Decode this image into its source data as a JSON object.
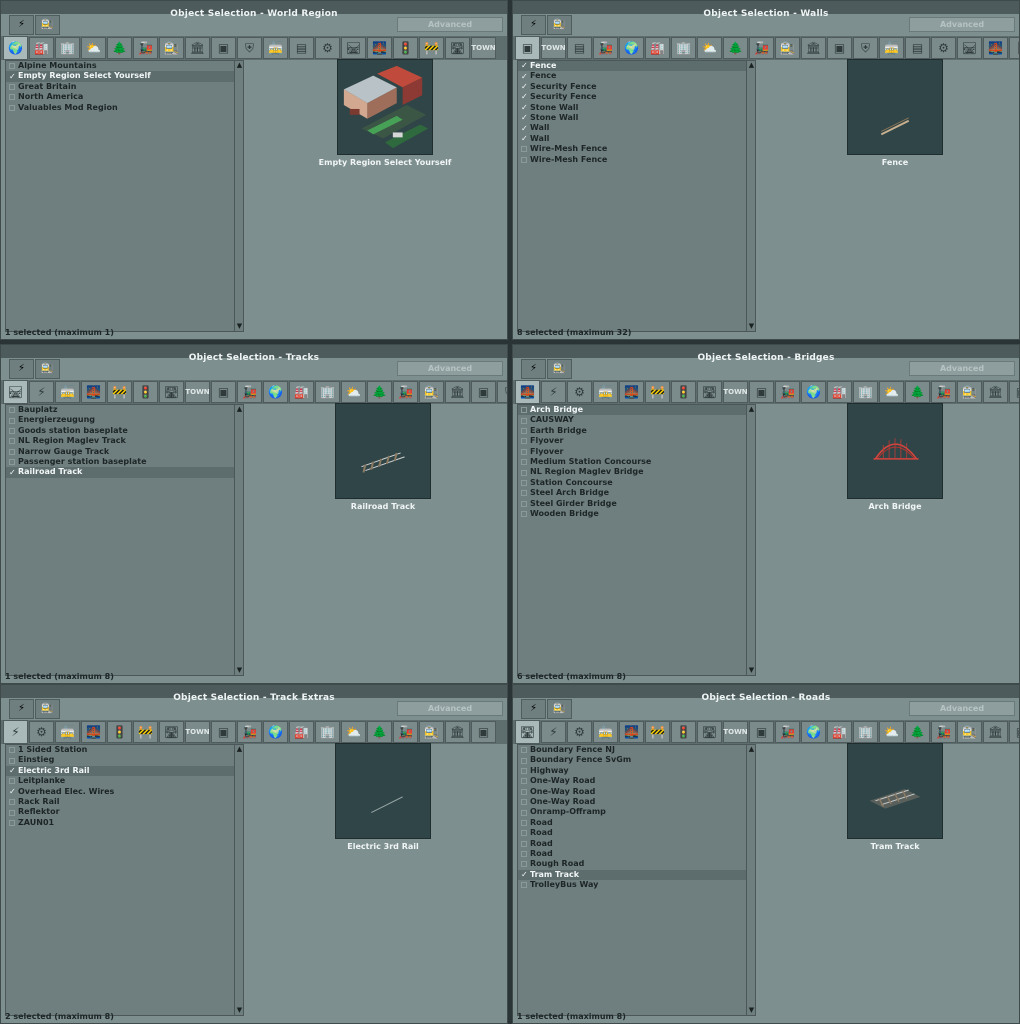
{
  "advanced_label": "Advanced",
  "panels": [
    {
      "title": "Object Selection - World Region",
      "top_tabs": [
        "rail-tab-icon",
        "loco-tab-icon"
      ],
      "tabs": [
        "🌍",
        "🏭",
        "🏢",
        "⛅",
        "🌲",
        "🚂",
        "🚉",
        "🏛",
        "▣",
        "⛨",
        "🚋",
        "▤",
        "⚙",
        "🛤",
        "🌉",
        "🚦",
        "🚧",
        "🛣",
        "TOWN"
      ],
      "active_tab": 0,
      "items": [
        {
          "label": "Alpine Mountains",
          "checked": false,
          "selected": false
        },
        {
          "label": "Empty Region Select Yourself",
          "checked": true,
          "selected": true
        },
        {
          "label": "Great Britain",
          "checked": false,
          "selected": false
        },
        {
          "label": "North America",
          "checked": false,
          "selected": false
        },
        {
          "label": "Valuables Mod Region",
          "checked": false,
          "selected": false
        }
      ],
      "preview_label": "Empty Region Select Yourself",
      "preview_kind": "region",
      "status": "1 selected (maximum 1)"
    },
    {
      "title": "Object Selection - Walls",
      "top_tabs": [
        "bridge-tab-icon",
        "signal-tab-icon"
      ],
      "tabs": [
        "▣",
        "TOWN",
        "▤",
        "🚂",
        "🌍",
        "🏭",
        "🏢",
        "⛅",
        "🌲",
        "🚂",
        "🚉",
        "🏛",
        "▣",
        "⛨",
        "🚋",
        "▤",
        "⚙",
        "🛤",
        "🌉",
        "🚦",
        "🚧"
      ],
      "active_tab": 0,
      "items": [
        {
          "label": "Fence",
          "checked": true,
          "selected": true
        },
        {
          "label": "Fence",
          "checked": true,
          "selected": false
        },
        {
          "label": "Security Fence",
          "checked": true,
          "selected": false
        },
        {
          "label": "Security Fence",
          "checked": true,
          "selected": false
        },
        {
          "label": "Stone Wall",
          "checked": true,
          "selected": false
        },
        {
          "label": "Stone Wall",
          "checked": true,
          "selected": false
        },
        {
          "label": "Wall",
          "checked": true,
          "selected": false
        },
        {
          "label": "Wall",
          "checked": true,
          "selected": false
        },
        {
          "label": "Wire-Mesh Fence",
          "checked": false,
          "selected": false
        },
        {
          "label": "Wire-Mesh Fence",
          "checked": false,
          "selected": false
        }
      ],
      "preview_label": "Fence",
      "preview_kind": "fence",
      "status": "8 selected (maximum 32)"
    },
    {
      "title": "Object Selection - Tracks",
      "top_tabs": [
        "electric-tab-icon",
        "station-tab-icon"
      ],
      "tabs": [
        "🛤",
        "⚡",
        "🚋",
        "🌉",
        "🚧",
        "🚦",
        "🛣",
        "TOWN",
        "▣",
        "🚂",
        "🌍",
        "🏭",
        "🏢",
        "⛅",
        "🌲",
        "🚂",
        "🚉",
        "🏛",
        "▣",
        "⛨"
      ],
      "active_tab": 0,
      "items": [
        {
          "label": "Bauplatz",
          "checked": false,
          "selected": false
        },
        {
          "label": "Energierzeugung",
          "checked": false,
          "selected": false
        },
        {
          "label": "Goods station baseplate",
          "checked": false,
          "selected": false
        },
        {
          "label": "NL Region Maglev Track",
          "checked": false,
          "selected": false
        },
        {
          "label": "Narrow Gauge Track",
          "checked": false,
          "selected": false
        },
        {
          "label": "Passenger station baseplate",
          "checked": false,
          "selected": false
        },
        {
          "label": "Railroad Track",
          "checked": true,
          "selected": true
        }
      ],
      "preview_label": "Railroad Track",
      "preview_kind": "track",
      "status": "1 selected (maximum 8)"
    },
    {
      "title": "Object Selection - Bridges",
      "top_tabs": [
        "gear-tab-icon",
        "station-tab-icon"
      ],
      "tabs": [
        "🌉",
        "⚡",
        "⚙",
        "🚋",
        "🌉",
        "🚧",
        "🚦",
        "🛣",
        "TOWN",
        "▣",
        "🚂",
        "🌍",
        "🏭",
        "🏢",
        "⛅",
        "🌲",
        "🚂",
        "🚉",
        "🏛",
        "▣"
      ],
      "active_tab": 0,
      "items": [
        {
          "label": "Arch Bridge",
          "checked": false,
          "selected": true
        },
        {
          "label": "CAUSWAY",
          "checked": false,
          "selected": false
        },
        {
          "label": "Earth Bridge",
          "checked": false,
          "selected": false
        },
        {
          "label": "Flyover",
          "checked": false,
          "selected": false
        },
        {
          "label": "Flyover",
          "checked": false,
          "selected": false
        },
        {
          "label": "Medium Station Concourse",
          "checked": false,
          "selected": false
        },
        {
          "label": "NL Region Maglev Bridge",
          "checked": false,
          "selected": false
        },
        {
          "label": "Station Concourse",
          "checked": false,
          "selected": false
        },
        {
          "label": "Steel Arch Bridge",
          "checked": false,
          "selected": false
        },
        {
          "label": "Steel Girder Bridge",
          "checked": false,
          "selected": false
        },
        {
          "label": "Wooden Bridge",
          "checked": false,
          "selected": false
        }
      ],
      "preview_label": "Arch Bridge",
      "preview_kind": "bridge",
      "status": "6 selected (maximum 8)"
    },
    {
      "title": "Object Selection - Track Extras",
      "top_tabs": [
        "station-tab-icon",
        "track-tab-icon"
      ],
      "tabs": [
        "⚡",
        "⚙",
        "🚋",
        "🌉",
        "🚦",
        "🚧",
        "🛣",
        "TOWN",
        "▣",
        "🚂",
        "🌍",
        "🏭",
        "🏢",
        "⛅",
        "🌲",
        "🚂",
        "🚉",
        "🏛",
        "▣"
      ],
      "active_tab": 0,
      "items": [
        {
          "label": "1 Sided Station",
          "checked": false,
          "selected": false
        },
        {
          "label": "Einstieg",
          "checked": false,
          "selected": false
        },
        {
          "label": "Electric 3rd Rail",
          "checked": true,
          "selected": true
        },
        {
          "label": "Leitplanke",
          "checked": false,
          "selected": false
        },
        {
          "label": "Overhead Elec. Wires",
          "checked": true,
          "selected": false
        },
        {
          "label": "Rack Rail",
          "checked": false,
          "selected": false
        },
        {
          "label": "Reflektor",
          "checked": false,
          "selected": false
        },
        {
          "label": "ZAUN01",
          "checked": false,
          "selected": false
        }
      ],
      "preview_label": "Electric 3rd Rail",
      "preview_kind": "rail",
      "status": "2 selected (maximum 8)"
    },
    {
      "title": "Object Selection - Roads",
      "top_tabs": [
        "depot-tab-icon",
        "bus-stop-tab-icon"
      ],
      "tabs": [
        "🛣",
        "⚡",
        "⚙",
        "🚋",
        "🌉",
        "🚧",
        "🚦",
        "🛣",
        "TOWN",
        "▣",
        "🚂",
        "🌍",
        "🏭",
        "🏢",
        "⛅",
        "🌲",
        "🚂",
        "🚉",
        "🏛",
        "▣"
      ],
      "active_tab": 0,
      "items": [
        {
          "label": "Boundary Fence NJ",
          "checked": false,
          "selected": false
        },
        {
          "label": "Boundary Fence SvGm",
          "checked": false,
          "selected": false
        },
        {
          "label": "Highway",
          "checked": false,
          "selected": false
        },
        {
          "label": "One-Way Road",
          "checked": false,
          "selected": false
        },
        {
          "label": "One-Way Road",
          "checked": false,
          "selected": false
        },
        {
          "label": "One-Way Road",
          "checked": false,
          "selected": false
        },
        {
          "label": "Onramp-Offramp",
          "checked": false,
          "selected": false
        },
        {
          "label": "Road",
          "checked": false,
          "selected": false
        },
        {
          "label": "Road",
          "checked": false,
          "selected": false
        },
        {
          "label": "Road",
          "checked": false,
          "selected": false
        },
        {
          "label": "Road",
          "checked": false,
          "selected": false
        },
        {
          "label": "Rough Road",
          "checked": false,
          "selected": false
        },
        {
          "label": "Tram Track",
          "checked": true,
          "selected": true
        },
        {
          "label": "TrolleyBus Way",
          "checked": false,
          "selected": false
        }
      ],
      "preview_label": "Tram Track",
      "preview_kind": "tram",
      "status": "1 selected (maximum 8)"
    }
  ]
}
